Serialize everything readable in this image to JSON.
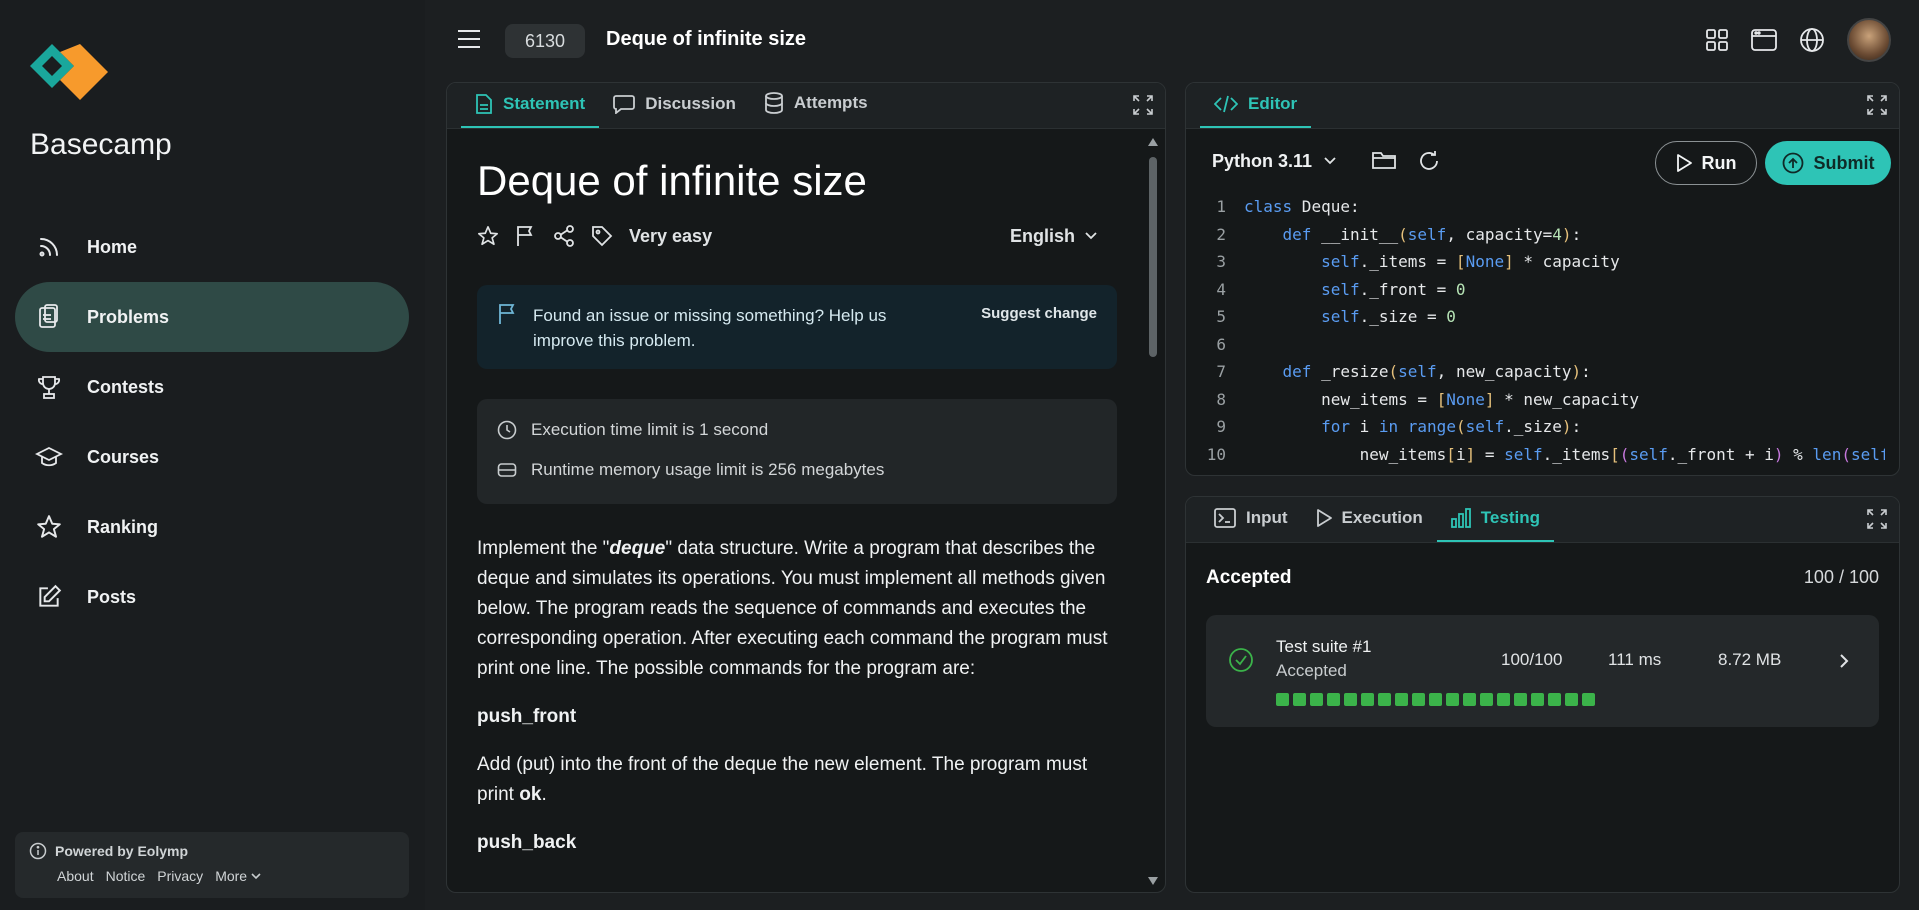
{
  "sidebar": {
    "brand": "Basecamp",
    "items": [
      {
        "label": "Home",
        "icon": "rss-icon"
      },
      {
        "label": "Problems",
        "icon": "clipboard-icon",
        "active": true
      },
      {
        "label": "Contests",
        "icon": "trophy-icon"
      },
      {
        "label": "Courses",
        "icon": "graduation-cap-icon"
      },
      {
        "label": "Ranking",
        "icon": "star-icon"
      },
      {
        "label": "Posts",
        "icon": "edit-icon"
      }
    ],
    "powered": {
      "text": "Powered by Eolymp",
      "links": [
        "About",
        "Notice",
        "Privacy",
        "More"
      ]
    }
  },
  "header": {
    "problem_id": "6130",
    "title": "Deque of infinite size"
  },
  "statement": {
    "tabs": [
      "Statement",
      "Discussion",
      "Attempts"
    ],
    "title": "Deque of infinite size",
    "difficulty": "Very easy",
    "language": "English",
    "notice": "Found an issue or missing something? Help us improve this problem.",
    "suggest": "Suggest change",
    "time_limit": "Execution time limit is 1 second",
    "memory_limit": "Runtime memory usage limit is 256 megabytes",
    "desc_pre": "Implement the \"",
    "desc_em": "deque",
    "desc_post": "\" data structure. Write a program that describes the deque and simulates its operations. You must implement all methods given below. The program reads the sequence of commands and executes the corresponding operation. After executing each command the program must print one line. The possible commands for the program are:",
    "cmd1": "push_front",
    "cmd1_desc_pre": "Add (put) into the front of the deque the new element. The program must print ",
    "cmd1_desc_ok": "ok",
    "cmd1_desc_post": ".",
    "cmd2": "push_back"
  },
  "editor": {
    "tab": "Editor",
    "language": "Python 3.11",
    "run": "Run",
    "submit": "Submit",
    "lines": [
      "class Deque:",
      "    def __init__(self, capacity=4):",
      "        self._items = [None] * capacity",
      "        self._front = 0",
      "        self._size = 0",
      "",
      "    def _resize(self, new_capacity):",
      "        new_items = [None] * new_capacity",
      "        for i in range(self._size):",
      "            new_items[i] = self._items[(self._front + i) % len(self."
    ]
  },
  "testing": {
    "tabs": [
      "Input",
      "Execution",
      "Testing"
    ],
    "verdict": "Accepted",
    "score": "100 / 100",
    "suite": {
      "name": "Test suite #1",
      "status": "Accepted",
      "points": "100/100",
      "time": "111 ms",
      "memory": "8.72 MB",
      "tests_passed": 19
    },
    "colors": {
      "accent": "#2ec4b6",
      "pass": "#3bb34a"
    }
  }
}
